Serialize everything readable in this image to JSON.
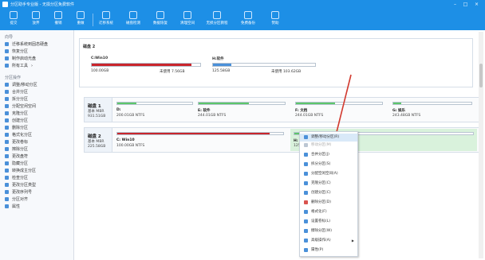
{
  "title_bar": {
    "title": "分区助手专业版 - 无损分区免费软件"
  },
  "toolbar": {
    "items": [
      {
        "label": "提交",
        "icon": "check-icon"
      },
      {
        "label": "放弃",
        "icon": "undo-icon"
      },
      {
        "label": "撤销",
        "icon": "back-icon"
      },
      {
        "label": "重做",
        "icon": "redo-icon"
      },
      {
        "label": "迁移系统",
        "icon": "migrate-icon"
      },
      {
        "label": "磁盘检测",
        "icon": "disk-check-icon"
      },
      {
        "label": "数据恢复",
        "icon": "recovery-icon"
      },
      {
        "label": "清理空间",
        "icon": "clean-icon"
      },
      {
        "label": "无损分区教程",
        "icon": "tutorial-icon"
      },
      {
        "label": "免费备份",
        "icon": "backup-icon"
      },
      {
        "label": "赞助",
        "icon": "heart-icon"
      }
    ]
  },
  "sidebar": {
    "wizard_heading": "向导",
    "wizard_items": [
      "迁移系统到固态硬盘",
      "恢复分区",
      "制作启动光盘",
      "所有工具"
    ],
    "ops_heading": "分区操作",
    "ops_items": [
      "调整/移动分区",
      "合并分区",
      "拆分分区",
      "分配空闲空间",
      "克隆分区",
      "创建分区",
      "删除分区",
      "格式化分区",
      "更改卷标",
      "擦除分区",
      "更改盘符",
      "隐藏分区",
      "转换成主分区",
      "检查分区",
      "更改分区类型",
      "更改序列号",
      "分区对齐",
      "属性"
    ]
  },
  "disks": [
    {
      "label": "磁盘 2",
      "partitions": [
        {
          "name": "C:Win10",
          "size": "100.00GB",
          "free_label": "未使用",
          "free": "7.56GB",
          "used": 0.92
        },
        {
          "name": "H:软件",
          "size": "125.58GB",
          "free_label": "未使用",
          "free": "103.62GB",
          "used": 0.18
        }
      ]
    },
    {
      "label": "磁盘 1",
      "type": "基本 MBR",
      "size": "931.51GB",
      "partitions": [
        {
          "name": "D:",
          "info": "200.01GB NTFS",
          "used": 0.25
        },
        {
          "name": "E: 软件",
          "info": "244.01GB NTFS",
          "used": 0.58
        },
        {
          "name": "F: 文档",
          "info": "244.01GB NTFS",
          "used": 0.45
        },
        {
          "name": "G: 娱乐",
          "info": "243.48GB NTFS",
          "used": 0.1
        }
      ]
    },
    {
      "label": "磁盘 2",
      "type": "基本 MBR",
      "size": "225.58GB",
      "partitions": [
        {
          "name": "C: Win10",
          "info": "100.00GB NTFS",
          "used": 0.92
        },
        {
          "name": "H: 软件",
          "info": "125.58GB NTFS",
          "used": 0.18
        }
      ]
    }
  ],
  "context_menu": [
    {
      "label": "调整/移动分区(R)",
      "selected": true
    },
    {
      "label": "移动分区(M)",
      "disabled": true
    },
    {
      "label": "合并分区(J)"
    },
    {
      "label": "拆分分区(S)"
    },
    {
      "label": "分配空闲空间(A)"
    },
    {
      "label": "克隆分区(C)"
    },
    {
      "label": "创建分区(C)"
    },
    {
      "label": "删除分区(D)"
    },
    {
      "label": "格式化(F)"
    },
    {
      "label": "设置卷标(L)"
    },
    {
      "label": "擦除分区(W)"
    },
    {
      "label": "高级操作(A)",
      "submenu": true
    },
    {
      "label": "属性(P)"
    }
  ],
  "colors": {
    "accent": "#1d8fe6",
    "used_red": "#c9262d",
    "used_green": "#5cc66a",
    "selection": "#d9f2dc",
    "arrow": "#d23a2f"
  }
}
